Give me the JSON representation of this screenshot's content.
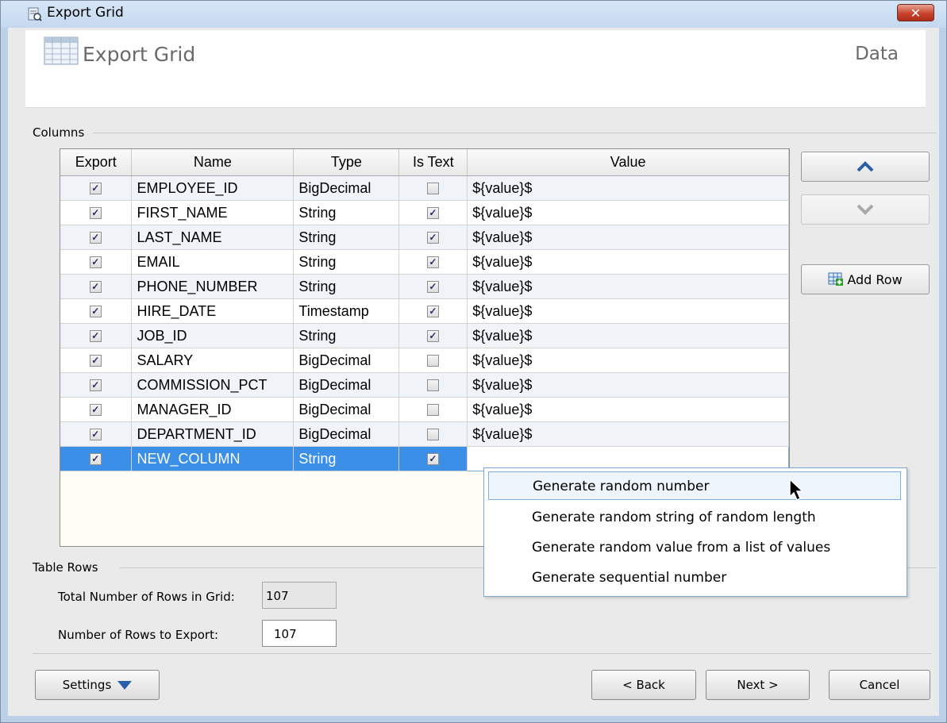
{
  "window": {
    "title": "Export Grid",
    "close_label": "✕"
  },
  "banner": {
    "title": "Export Grid",
    "section": "Data"
  },
  "columns_group": {
    "label": "Columns"
  },
  "grid": {
    "headers": [
      "Export",
      "Name",
      "Type",
      "Is Text",
      "Value"
    ],
    "rows": [
      {
        "export": true,
        "name": "EMPLOYEE_ID",
        "type": "BigDecimal",
        "is_text": false,
        "value": "${value}$"
      },
      {
        "export": true,
        "name": "FIRST_NAME",
        "type": "String",
        "is_text": true,
        "value": "${value}$"
      },
      {
        "export": true,
        "name": "LAST_NAME",
        "type": "String",
        "is_text": true,
        "value": "${value}$"
      },
      {
        "export": true,
        "name": "EMAIL",
        "type": "String",
        "is_text": true,
        "value": "${value}$"
      },
      {
        "export": true,
        "name": "PHONE_NUMBER",
        "type": "String",
        "is_text": true,
        "value": "${value}$"
      },
      {
        "export": true,
        "name": "HIRE_DATE",
        "type": "Timestamp",
        "is_text": true,
        "value": "${value}$"
      },
      {
        "export": true,
        "name": "JOB_ID",
        "type": "String",
        "is_text": true,
        "value": "${value}$"
      },
      {
        "export": true,
        "name": "SALARY",
        "type": "BigDecimal",
        "is_text": false,
        "value": "${value}$"
      },
      {
        "export": true,
        "name": "COMMISSION_PCT",
        "type": "BigDecimal",
        "is_text": false,
        "value": "${value}$"
      },
      {
        "export": true,
        "name": "MANAGER_ID",
        "type": "BigDecimal",
        "is_text": false,
        "value": "${value}$"
      },
      {
        "export": true,
        "name": "DEPARTMENT_ID",
        "type": "BigDecimal",
        "is_text": false,
        "value": "${value}$"
      },
      {
        "export": true,
        "name": "NEW_COLUMN",
        "type": "String",
        "is_text": true,
        "value": "",
        "selected": true
      }
    ]
  },
  "side_buttons": {
    "add_row": "Add Row"
  },
  "table_rows_group": {
    "label": "Table Rows",
    "total_label": "Total Number of Rows in Grid:",
    "total_value": "107",
    "export_label": "Number of Rows to Export:",
    "export_value": "107"
  },
  "footer": {
    "settings": "Settings",
    "back": "< Back",
    "next": "Next >",
    "cancel": "Cancel"
  },
  "popup_menu": {
    "items": [
      "Generate random number",
      "Generate random string of random length",
      "Generate random value from a list of values",
      "Generate sequential number"
    ]
  },
  "colors": {
    "selection": "#3b8fe6",
    "accent_arrow": "#2a5ea8"
  }
}
